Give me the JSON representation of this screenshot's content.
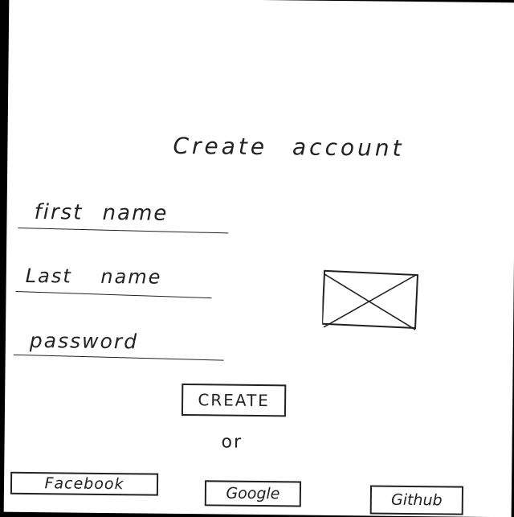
{
  "page": {
    "title": "Create account"
  },
  "form": {
    "first_name_placeholder": "first name",
    "last_name_placeholder": "Last name",
    "password_placeholder": "password"
  },
  "actions": {
    "create_label": "CREATE",
    "separator": "or"
  },
  "social": {
    "facebook_label": "Facebook",
    "google_label": "Google",
    "github_label": "Github"
  },
  "image_placeholder": {
    "icon": "image-placeholder-icon"
  },
  "colors": {
    "ink": "#222222",
    "paper": "#ffffff"
  }
}
